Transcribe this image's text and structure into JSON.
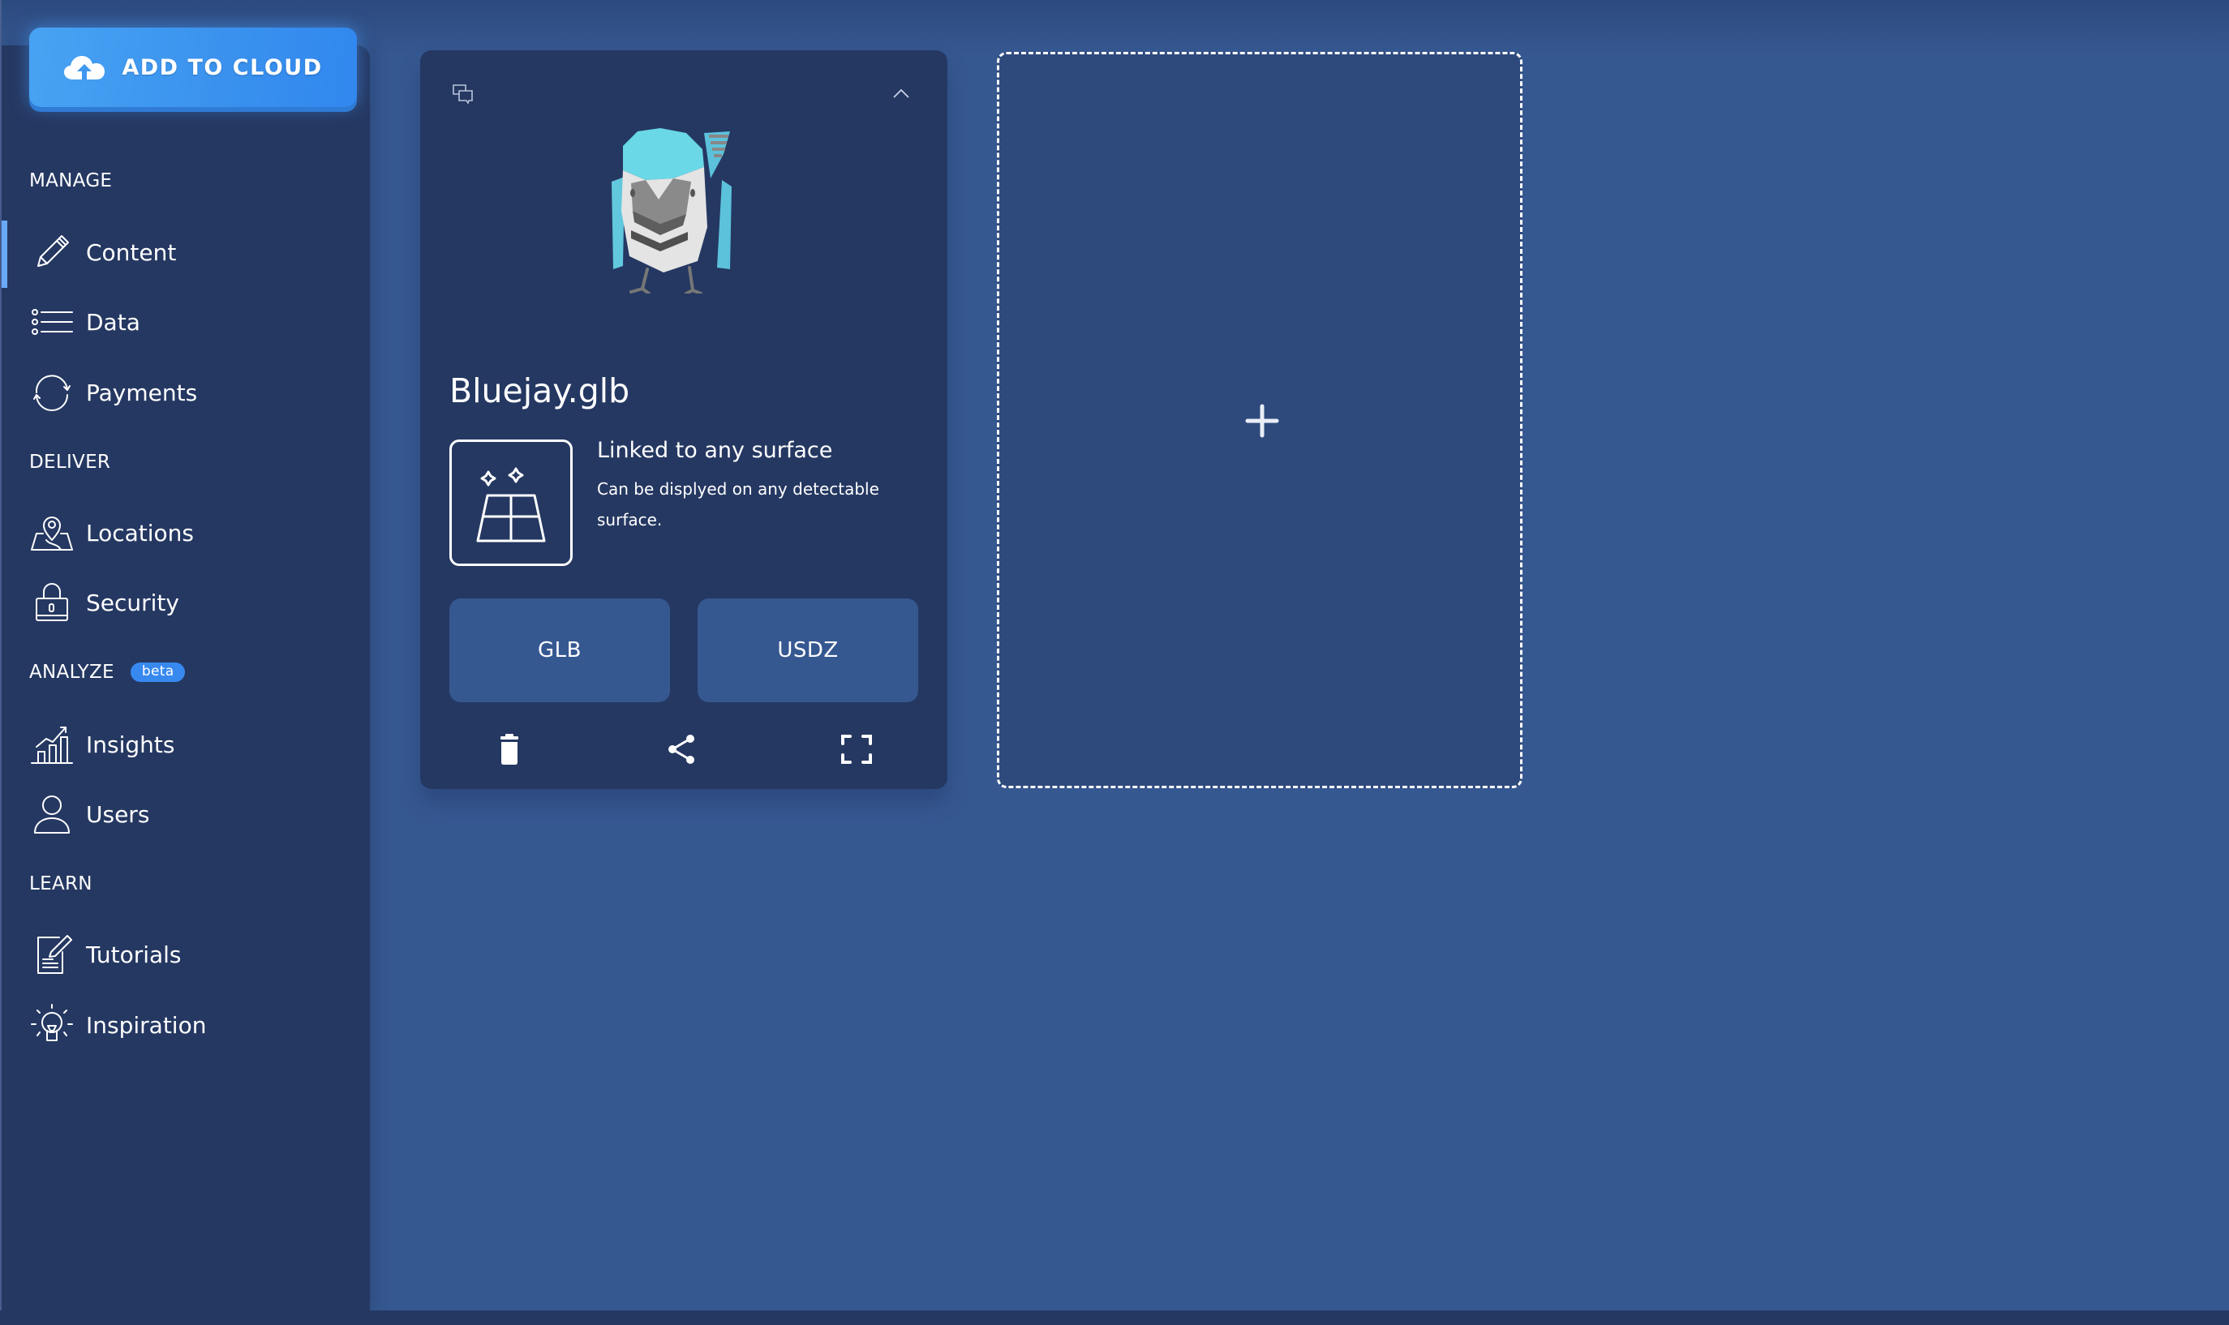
{
  "sidebar": {
    "add_button": {
      "label": "ADD TO CLOUD",
      "icon": "cloud-upload-icon"
    },
    "sections": [
      {
        "heading": "MANAGE",
        "items": [
          {
            "label": "Content",
            "icon": "pencil-icon",
            "active": true
          },
          {
            "label": "Data",
            "icon": "list-icon",
            "active": false
          },
          {
            "label": "Payments",
            "icon": "refresh-cycle-icon",
            "active": false
          }
        ]
      },
      {
        "heading": "DELIVER",
        "items": [
          {
            "label": "Locations",
            "icon": "map-pin-icon",
            "active": false
          },
          {
            "label": "Security",
            "icon": "lock-icon",
            "active": false
          }
        ]
      },
      {
        "heading": "ANALYZE",
        "badge": "beta",
        "items": [
          {
            "label": "Insights",
            "icon": "bar-chart-icon",
            "active": false
          },
          {
            "label": "Users",
            "icon": "user-icon",
            "active": false
          }
        ]
      },
      {
        "heading": "LEARN",
        "items": [
          {
            "label": "Tutorials",
            "icon": "document-edit-icon",
            "active": false
          },
          {
            "label": "Inspiration",
            "icon": "lightbulb-icon",
            "active": false
          }
        ]
      }
    ]
  },
  "content_card": {
    "title": "Bluejay.glb",
    "preview": "bluejay-3d-model",
    "anchor": {
      "title": "Linked to any surface",
      "description": "Can be displyed on any detectable surface.",
      "icon": "surface-sparkle-icon"
    },
    "formats": [
      {
        "label": "GLB"
      },
      {
        "label": "USDZ"
      }
    ],
    "actions": [
      "delete",
      "share",
      "fullscreen"
    ]
  },
  "add_card": {
    "icon": "plus-icon"
  },
  "colors": {
    "background": "#365891",
    "sidebar": "#253862",
    "card": "#253862",
    "accent": "#3b93ee",
    "active_indicator": "#6aa9f5",
    "badge": "#3789f0",
    "format_button": "#365891",
    "add_card": "#2e4a7d"
  }
}
